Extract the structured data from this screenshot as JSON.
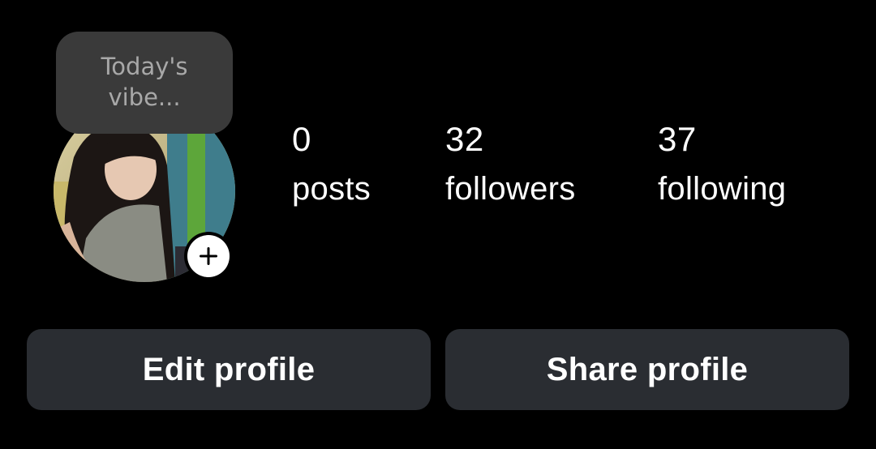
{
  "note": {
    "text": "Today's vibe..."
  },
  "avatar": {
    "alt": "profile photo",
    "add_icon": "plus-icon"
  },
  "stats": {
    "posts": {
      "count": "0",
      "label": "posts"
    },
    "followers": {
      "count": "32",
      "label": "followers"
    },
    "following": {
      "count": "37",
      "label": "following"
    }
  },
  "actions": {
    "edit_label": "Edit profile",
    "share_label": "Share profile"
  },
  "colors": {
    "background": "#000000",
    "button_bg": "#2a2d32",
    "note_bg": "#3a3a3a",
    "note_text": "#a8a8a8",
    "text": "#ffffff"
  }
}
